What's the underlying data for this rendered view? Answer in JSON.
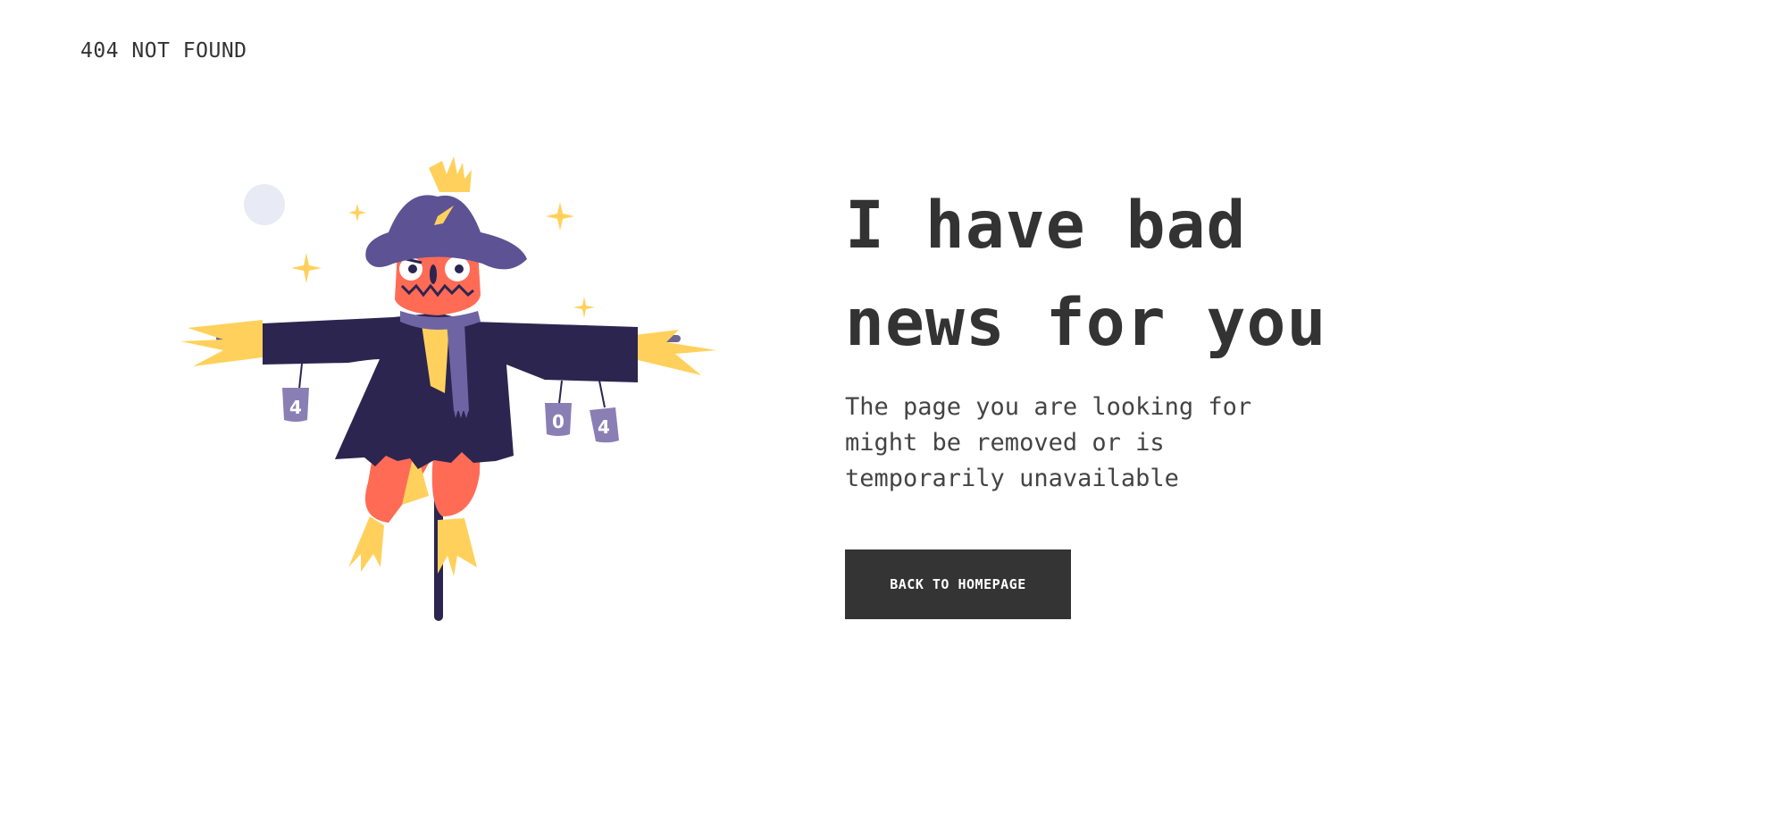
{
  "header": {
    "label": "404 NOT FOUND"
  },
  "main": {
    "headline_line1": "I have bad",
    "headline_line2": "news for you",
    "description": "The page you are looking for might be removed or is temporarily unavailable",
    "button_label": "BACK TO HOMEPAGE"
  },
  "illustration": {
    "name": "scarecrow-illustration",
    "cans": [
      "4",
      "0",
      "4"
    ],
    "colors": {
      "hat": "#5d5294",
      "coat": "#2c2550",
      "face": "#ff6b55",
      "straw": "#ffd15c",
      "can": "#8a7fb5",
      "moon": "#e8ebf5"
    }
  }
}
